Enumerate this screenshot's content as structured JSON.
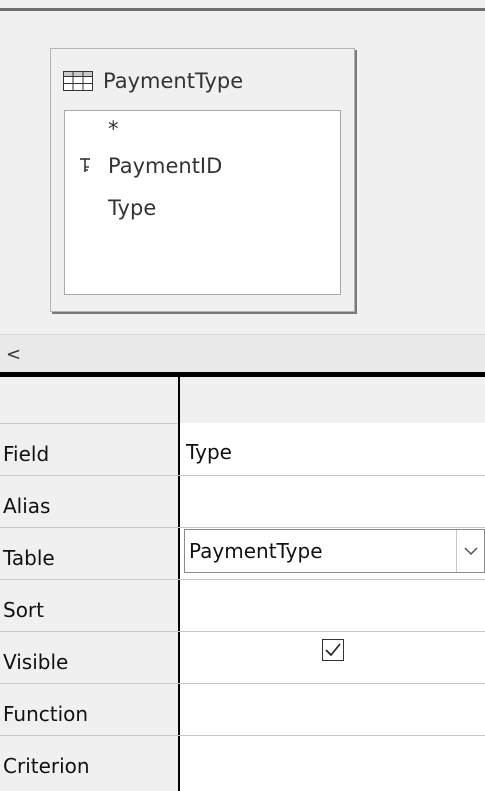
{
  "table_window": {
    "title": "PaymentType",
    "icon": "table-icon",
    "fields": [
      {
        "label": "*",
        "is_key": false
      },
      {
        "label": "PaymentID",
        "is_key": true
      },
      {
        "label": "Type",
        "is_key": false
      }
    ]
  },
  "scrollbar": {
    "left_arrow": "<"
  },
  "grid": {
    "rows": {
      "field": "Field",
      "alias": "Alias",
      "table": "Table",
      "sort": "Sort",
      "visible": "Visible",
      "function": "Function",
      "criterion": "Criterion"
    },
    "column1": {
      "field": "Type",
      "alias": "",
      "table": "PaymentType",
      "sort": "",
      "visible": true,
      "function": "",
      "criterion": ""
    }
  }
}
